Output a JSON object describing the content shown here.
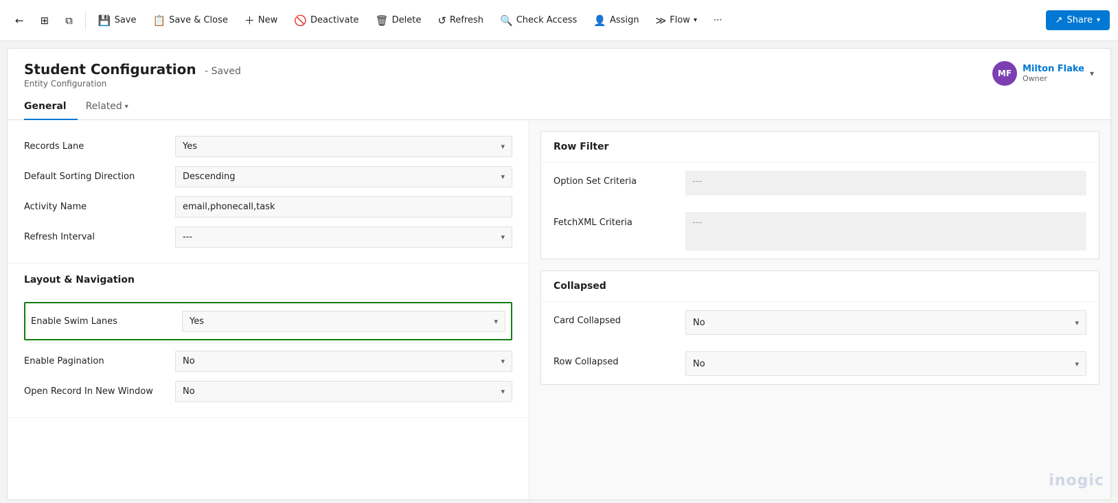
{
  "toolbar": {
    "back_icon": "←",
    "grid_icon": "⊞",
    "popup_icon": "⧉",
    "save_label": "Save",
    "save_close_label": "Save & Close",
    "new_label": "New",
    "deactivate_label": "Deactivate",
    "delete_label": "Delete",
    "refresh_label": "Refresh",
    "check_access_label": "Check Access",
    "assign_label": "Assign",
    "flow_label": "Flow",
    "more_icon": "⋯",
    "share_label": "Share"
  },
  "record": {
    "title": "Student Configuration",
    "saved_status": "- Saved",
    "subtitle": "Entity Configuration",
    "owner_initials": "MF",
    "owner_name": "Milton Flake",
    "owner_role": "Owner"
  },
  "tabs": [
    {
      "label": "General",
      "active": true
    },
    {
      "label": "Related",
      "has_chevron": true,
      "active": false
    }
  ],
  "left_fields": [
    {
      "label": "Records Lane",
      "value": "Yes",
      "type": "dropdown"
    },
    {
      "label": "Default Sorting Direction",
      "value": "Descending",
      "type": "dropdown"
    },
    {
      "label": "Activity Name",
      "value": "email,phonecall,task",
      "type": "text"
    },
    {
      "label": "Refresh Interval",
      "value": "---",
      "type": "dropdown"
    }
  ],
  "layout_section": {
    "title": "Layout & Navigation",
    "fields": [
      {
        "label": "Enable Swim Lanes",
        "value": "Yes",
        "type": "dropdown",
        "highlighted": true
      },
      {
        "label": "Enable Pagination",
        "value": "No",
        "type": "dropdown"
      },
      {
        "label": "Open Record In New Window",
        "value": "No",
        "type": "dropdown"
      }
    ]
  },
  "right_sections": [
    {
      "title": "Row Filter",
      "fields": [
        {
          "label": "Option Set Criteria",
          "value": "---",
          "type": "readonly"
        },
        {
          "label": "FetchXML Criteria",
          "value": "---",
          "type": "readonly"
        }
      ]
    },
    {
      "title": "Collapsed",
      "fields": [
        {
          "label": "Card Collapsed",
          "value": "No",
          "type": "dropdown"
        },
        {
          "label": "Row Collapsed",
          "value": "No",
          "type": "dropdown"
        }
      ]
    }
  ],
  "watermark": "inogic"
}
